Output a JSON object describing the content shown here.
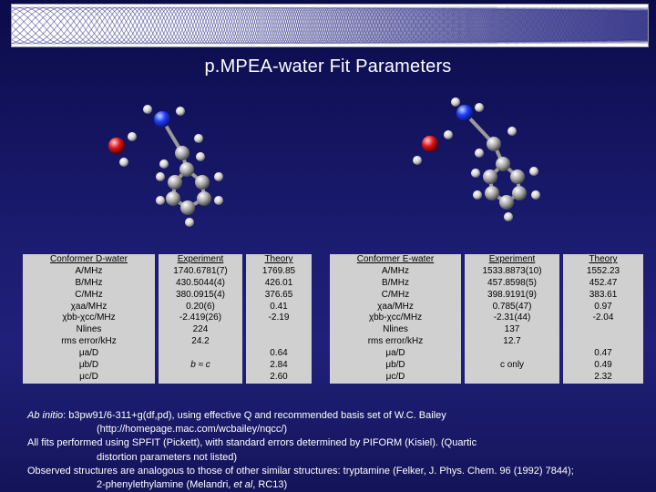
{
  "title": "p.MPEA-water Fit Parameters",
  "colors": {
    "background": "#1a1a6e",
    "table": "#d0d0d0",
    "nitrogen": "#1e3cff",
    "oxygen": "#e01818",
    "carbon": "#b0b0b0"
  },
  "table_d": {
    "param_header": "Conformer D-water",
    "exp_header": "Experiment",
    "theory_header": "Theory",
    "rows": [
      {
        "p": "A/MHz",
        "e": "1740.6781(7)",
        "t": "1769.85"
      },
      {
        "p": "B/MHz",
        "e": "430.5044(4)",
        "t": "426.01"
      },
      {
        "p": "C/MHz",
        "e": "380.0915(4)",
        "t": "376.65"
      },
      {
        "p": "χaa/MHz",
        "e": "0.20(6)",
        "t": "0.41"
      },
      {
        "p": "χbb-χcc/MHz",
        "e": "-2.419(26)",
        "t": "-2.19"
      },
      {
        "p": "Nlines",
        "e": "224",
        "t": ""
      },
      {
        "p": "rms error/kHz",
        "e": "24.2",
        "t": ""
      },
      {
        "p": "μa/D",
        "e": "",
        "t": "0.64"
      },
      {
        "p": "μb/D",
        "e": "b ≈ c",
        "t": "2.84"
      },
      {
        "p": "μc/D",
        "e": "",
        "t": "2.60"
      }
    ]
  },
  "table_e": {
    "param_header": "Conformer E-water",
    "exp_header": "Experiment",
    "theory_header": "Theory",
    "rows": [
      {
        "p": "A/MHz",
        "e": "1533.8873(10)",
        "t": "1552.23"
      },
      {
        "p": "B/MHz",
        "e": "457.8598(5)",
        "t": "452.47"
      },
      {
        "p": "C/MHz",
        "e": "398.9191(9)",
        "t": "383.61"
      },
      {
        "p": "χaa/MHz",
        "e": "0.785(47)",
        "t": "0.97"
      },
      {
        "p": "χbb-χcc/MHz",
        "e": "-2.31(44)",
        "t": "-2.04"
      },
      {
        "p": "Nlines",
        "e": "137",
        "t": ""
      },
      {
        "p": "rms error/kHz",
        "e": "12.7",
        "t": ""
      },
      {
        "p": "μa/D",
        "e": "",
        "t": "0.47"
      },
      {
        "p": "μb/D",
        "e": "c only",
        "t": "0.49"
      },
      {
        "p": "μc/D",
        "e": "",
        "t": "2.32"
      }
    ]
  },
  "notes": {
    "ab_initio_label": "Ab initio",
    "line1": ": b3pw91/6-311+g(df,pd), using effective Q and recommended basis set of W.C. Bailey",
    "line2": "(http://homepage.mac.com/wcbailey/nqcc/)",
    "line3": "All fits performed using SPFIT (Pickett), with standard errors determined by PIFORM (Kisiel). (Quartic",
    "line4": "distortion parameters not listed)",
    "line5": "Observed structures are analogous to those of other similar structures:  tryptamine (Felker, J. Phys. Chem. 96 (1992) 7844);",
    "line6a": "2-phenylethylamine (Melandri, ",
    "line6b": "et al",
    "line6c": ", RC13)"
  }
}
